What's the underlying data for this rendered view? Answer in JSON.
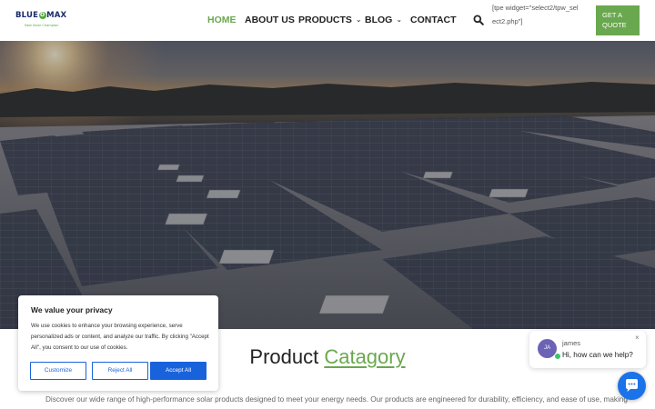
{
  "brand": {
    "logo_part1": "BLUE",
    "logo_o": "O",
    "logo_part2": "MAX",
    "tagline": "New Solar Champion",
    "accent_color": "#6aa84f"
  },
  "nav": {
    "home": "HOME",
    "about": "ABOUT US",
    "products": "PRODUCTS",
    "blog": "BLOG",
    "contact": "CONTACT",
    "dropdown_glyph": "⌄",
    "search_icon": "search-icon"
  },
  "header": {
    "shortcode_text": "[tpe widget=\"select2/tpw_select2.php\"]",
    "quote_button": "GET A QUOTE"
  },
  "cookie": {
    "title": "We value your privacy",
    "text": "We use cookies to enhance your browsing experience, serve personalized ads or content, and analyze our traffic. By clicking \"Accept All\", you consent to our use of cookies.",
    "customize": "Customize",
    "reject": "Reject All",
    "accept": "Accept All",
    "button_color": "#1863dc"
  },
  "section": {
    "title_plain": "Product ",
    "title_accent": "Catagory",
    "description": "Discover our wide range of high-performance solar products designed to meet your energy needs. Our products are engineered for durability, efficiency, and ease of use, making"
  },
  "chat": {
    "avatar_initials": "JA",
    "agent_name": "james",
    "message": "Hi, how can we help?",
    "close_glyph": "×",
    "launcher_color": "#1a73e8"
  }
}
